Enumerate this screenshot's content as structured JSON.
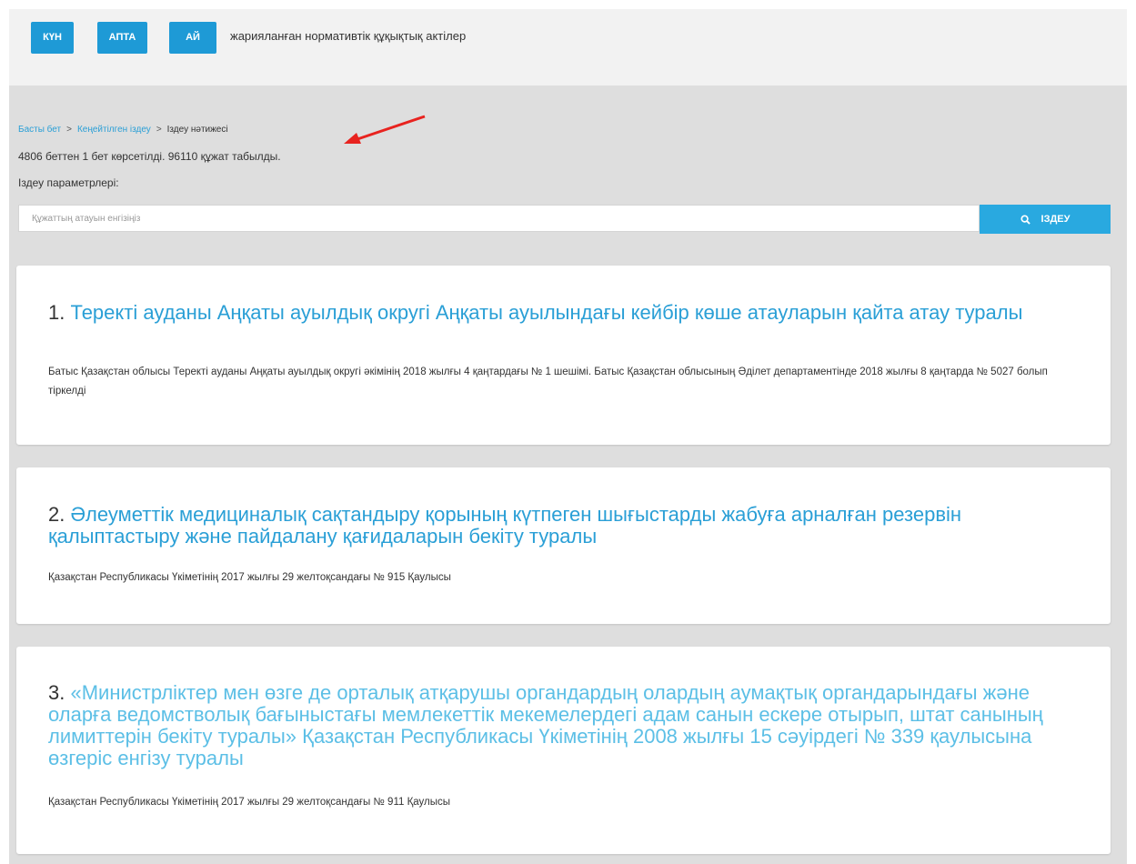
{
  "periods": [
    "КҮН",
    "АПТА",
    "АЙ"
  ],
  "period_caption": "жарияланған нормативтік құқықтық актілер",
  "breadcrumb": {
    "home": "Басты бет",
    "separator": ">",
    "advanced": "Кеңейтілген іздеу",
    "current": "Іздеу нәтижесі"
  },
  "results_summary": "4806 беттен 1 бет көрсетілді. 96110 құжат табылды.",
  "search_params_label": "Іздеу параметрлері:",
  "search": {
    "placeholder": "Құжаттың атауын енгізіңіз",
    "button_label": "ІЗДЕУ"
  },
  "results": [
    {
      "number": "1.",
      "title": "Теректі ауданы Аңқаты ауылдық округі Аңқаты ауылындағы кейбір көше атауларын қайта атау туралы",
      "description": "Батыс Қазақстан облысы Теректі ауданы Аңқаты ауылдық округі әкімінің 2018 жылғы 4 қаңтардағы № 1 шешімі. Батыс Қазақстан облысының Әділет департаментінде 2018 жылғы 8 қаңтарда № 5027 болып тіркелді"
    },
    {
      "number": "2.",
      "title": "Әлеуметтік медициналық сақтандыру қорының күтпеген шығыстарды жабуға арналған резервін қалыптастыру және пайдалану қағидаларын бекіту туралы",
      "description": "Қазақстан Республикасы Үкіметінің 2017 жылғы 29 желтоқсандағы № 915 Қаулысы"
    },
    {
      "number": "3.",
      "title": "«Министрліктер мен өзге де орталық атқарушы органдардың олардың аумақтық органдарындағы және оларға ведомстволық бағыныстағы мемлекеттік мекемелердегі адам санын ескере отырып, штат санының лимиттерін бекіту туралы» Қазақстан Республикасы Үкіметінің 2008 жылғы 15 сәуірдегі № 339 қаулысына өзгеріс енгізу туралы",
      "description": "Қазақстан Республикасы Үкіметінің 2017 жылғы 29 желтоқсандағы № 911 Қаулысы"
    }
  ],
  "colors": {
    "accent": "#1e9ad6",
    "link": "#2a9fd6",
    "annotation_arrow": "#e8231f"
  }
}
